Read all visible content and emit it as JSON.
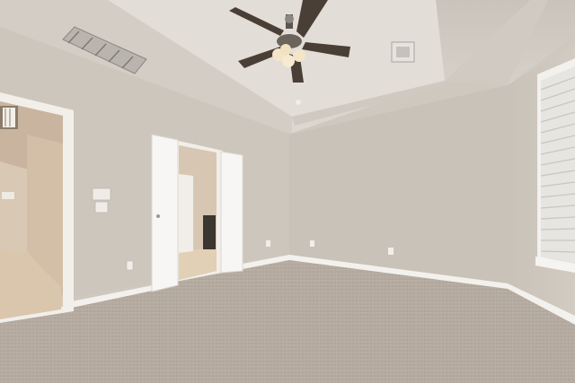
{
  "scene": {
    "kind": "photo",
    "palette": {
      "wall": "#cdc6bd",
      "wall_shadow": "#bfb7ad",
      "ceiling": "#ddd8d1",
      "trim": "#f4f2ee",
      "carpet": "#b9afa6",
      "door": "#f7f6f4"
    },
    "icons": [
      "ceiling-fan-icon",
      "air-vent-icon",
      "light-switch-icon",
      "outlet-icon"
    ]
  }
}
